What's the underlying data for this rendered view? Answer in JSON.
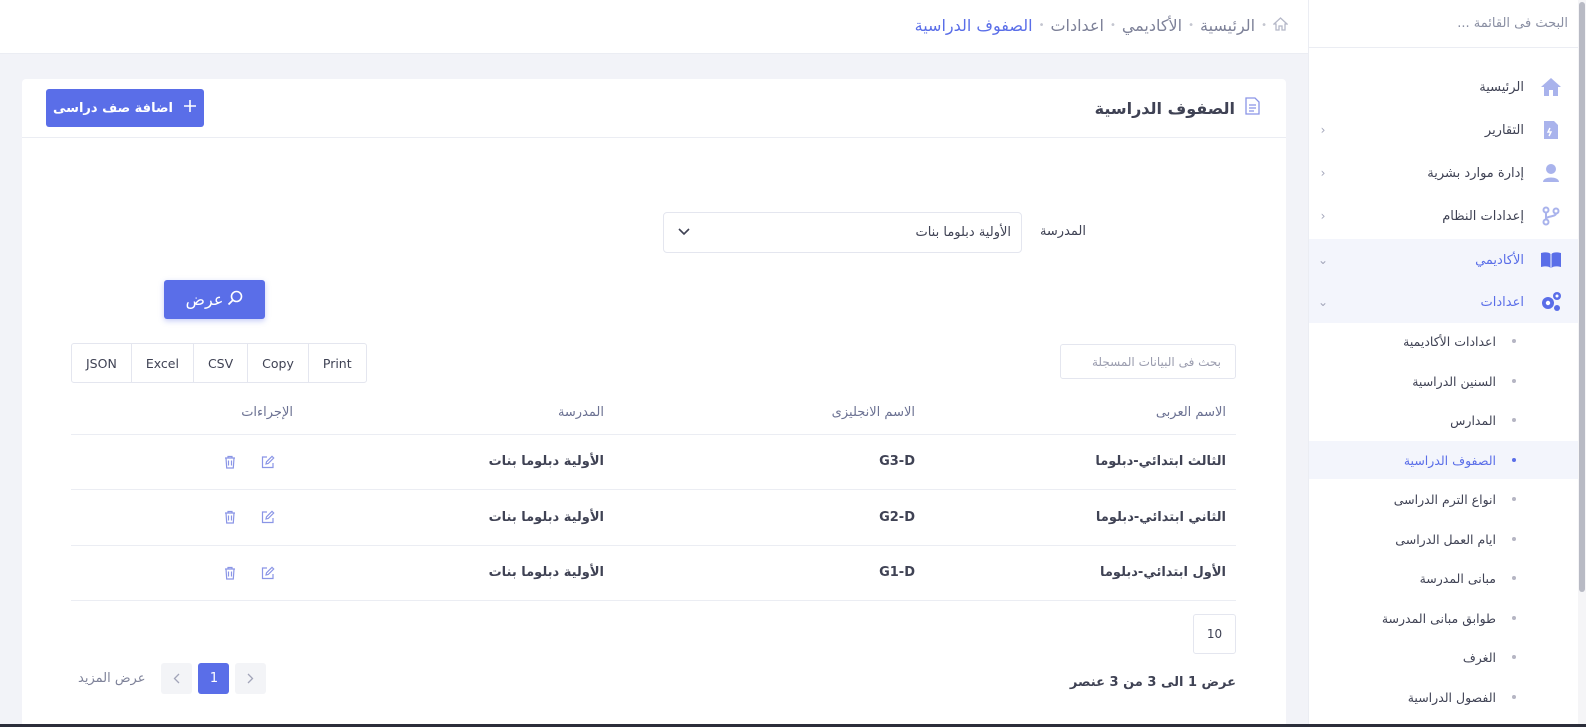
{
  "sidebar": {
    "search_placeholder": "البحث فى القائمة ...",
    "items": [
      {
        "label": "الرئيسية",
        "icon": "home-icon"
      },
      {
        "label": "التقارير",
        "icon": "report-icon"
      },
      {
        "label": "إدارة موارد بشرية",
        "icon": "user-icon"
      },
      {
        "label": "إعدادات النظام",
        "icon": "branch-icon"
      },
      {
        "label": "الأكاديمي",
        "icon": "book-icon"
      },
      {
        "label": "اعدادات",
        "icon": "gears-icon"
      }
    ],
    "sub_items": [
      "اعدادات الأكاديمية",
      "السنين الدراسية",
      "المدارس",
      "الصفوف الدراسية",
      "انواع الترم الدراسى",
      "ايام العمل الدراسى",
      "مبانى المدرسة",
      "طوابق مبانى المدرسة",
      "الغرف",
      "الفصول الدراسية"
    ]
  },
  "breadcrumb": {
    "items": [
      "الرئيسية",
      "الأكاديمي",
      "اعدادات"
    ],
    "current": "الصفوف الدراسية"
  },
  "card": {
    "title": "الصفوف الدراسية",
    "add_button": "اضافة صف دراسى"
  },
  "filter": {
    "school_label": "المدرسة",
    "school_value": "الأولية دبلوما بنات",
    "view_button": "عرض"
  },
  "table": {
    "search_placeholder": "بحث فى البيانات المسجلة",
    "export_buttons": [
      "Print",
      "Copy",
      "CSV",
      "Excel",
      "JSON"
    ],
    "headers": [
      "الاسم العربى",
      "الاسم الانجليزى",
      "المدرسة",
      "الإجراءات"
    ],
    "rows": [
      {
        "arabic_name": "الثالث ابتدائي-دبلوما",
        "english_name": "G3-D",
        "school": "الأولية دبلوما بنات"
      },
      {
        "arabic_name": "الثاني ابتدائي-دبلوما",
        "english_name": "G2-D",
        "school": "الأولية دبلوما بنات"
      },
      {
        "arabic_name": "الأول ابتدائي-دبلوما",
        "english_name": "G1-D",
        "school": "الأولية دبلوما بنات"
      }
    ],
    "page_size": "10",
    "info": "عرض 1 الى 3 من 3 عنصر",
    "current_page": "1",
    "show_more": "عرض المزيد"
  },
  "colors": {
    "accent": "#5a6ee8",
    "icon_blue": "#7f8fe6"
  }
}
